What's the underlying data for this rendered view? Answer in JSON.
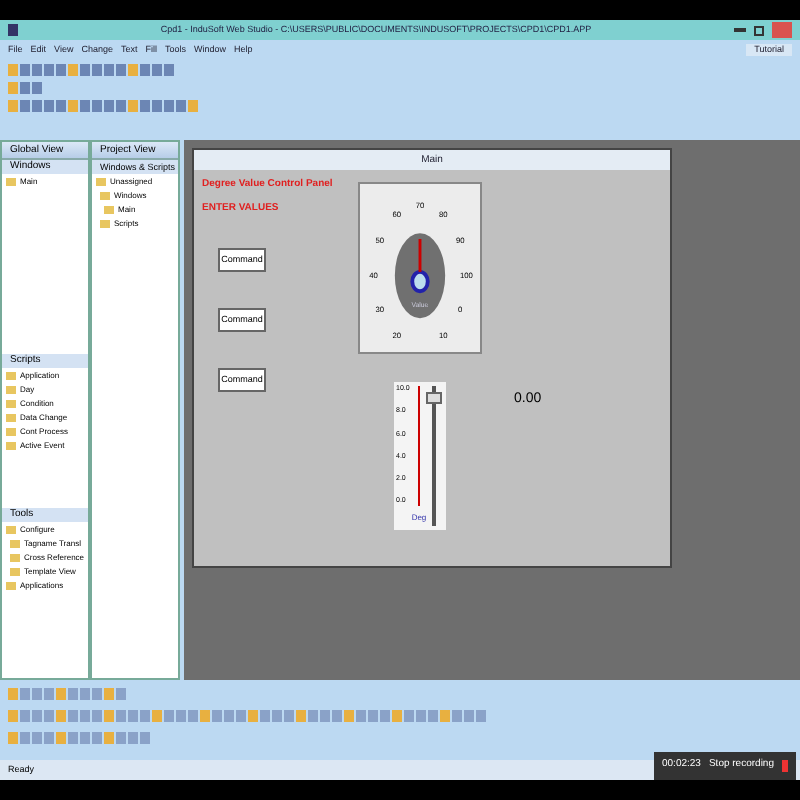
{
  "window": {
    "title": "Cpd1 - InduSoft Web Studio - C:\\USERS\\PUBLIC\\DOCUMENTS\\INDUSOFT\\PROJECTS\\CPD1\\CPD1.APP"
  },
  "menu": [
    "File",
    "Edit",
    "View",
    "Change",
    "Text",
    "Fill",
    "Tools",
    "Window",
    "Help"
  ],
  "help_button": "Tutorial",
  "global_view": {
    "title": "Global View",
    "section": "Windows",
    "items": [
      "Main"
    ],
    "scripts_section": "Scripts",
    "scripts": [
      "Application",
      "Day",
      "Condition",
      "Data Change",
      "Cont Process",
      "Active Event"
    ],
    "tools_section": "Tools",
    "tools": [
      {
        "label": "Configure",
        "children": [
          {
            "label": "Tagname Transl"
          },
          {
            "label": "Cross Reference"
          },
          {
            "label": "Template View"
          }
        ]
      },
      {
        "label": "Applications"
      }
    ]
  },
  "project_view": {
    "title": "Project View",
    "section": "Windows & Scripts",
    "tree": [
      {
        "label": "Unassigned",
        "children": [
          {
            "label": "Windows",
            "children": [
              {
                "label": "Main"
              }
            ]
          },
          {
            "label": "Scripts"
          }
        ]
      }
    ]
  },
  "screen": {
    "title": "Main",
    "heading": "Degree Value Control Panel",
    "subheading": "ENTER VALUES",
    "buttons": [
      "Command",
      "Command",
      "Command"
    ],
    "gauge_ticks": [
      "20",
      "30",
      "40",
      "50",
      "60",
      "70",
      "80",
      "90",
      "100",
      "0",
      "10"
    ],
    "gauge_label": "Value",
    "readout": "0.00",
    "thermo_ticks": [
      "10.0",
      "8.0",
      "6.0",
      "4.0",
      "2.0",
      "0.0"
    ],
    "thermo_label": "Deg",
    "slider": {
      "level": 0.95
    }
  },
  "recording": {
    "time": "00:02:23",
    "label": "Stop recording"
  },
  "status_bar": "Ready"
}
